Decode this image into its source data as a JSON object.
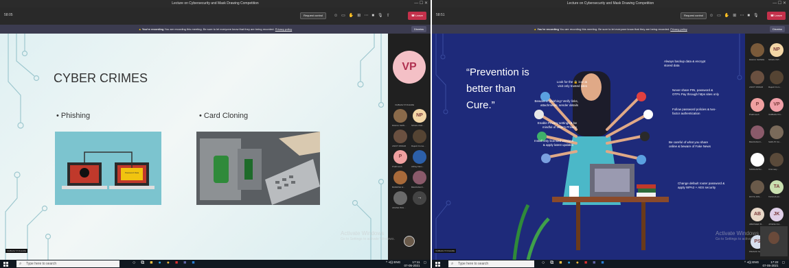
{
  "left": {
    "window_title": "Lecture on Cybersecurity and Mask Drawing Competition",
    "timer": "58:05",
    "request_control": "Request control",
    "leave": "Leave",
    "recording_prefix": "You're recording",
    "recording_notice": "You are recording this meeting. Be sure to let everyone know that they are being recorded.",
    "privacy_policy": "Privacy policy",
    "dismiss": "Dismiss",
    "slide": {
      "title": "CYBER CRIMES",
      "bullet1": "Phishing",
      "bullet2": "Card Cloning",
      "phish_sign": "Password Data"
    },
    "presenter": {
      "initials": "VP",
      "name": "VAIBHAV POKHARE"
    },
    "participants": [
      {
        "initials": "",
        "name": "RAHUL SHIN...",
        "color": "#8a6a4a"
      },
      {
        "initials": "NP",
        "name": "NIKHIL PAR...",
        "color": "#f3d6a6"
      },
      {
        "initials": "",
        "name": "ANKIT PAWAR",
        "color": "#6a5040"
      },
      {
        "initials": "",
        "name": "Rajesh Kuma...",
        "color": "#554433"
      },
      {
        "initials": "P",
        "name": "Prathmesh",
        "color": "#f0a0a0"
      },
      {
        "initials": "",
        "name": "Abhay Dam...",
        "color": "#2c5fa8"
      },
      {
        "initials": "",
        "name": "BANDISH H...",
        "color": "#a86a3a"
      },
      {
        "initials": "",
        "name": "BHAVANA D...",
        "color": "#8a5a6a"
      },
      {
        "initials": "",
        "name": "AKASH PAG...",
        "color": "#6a6a6a"
      }
    ],
    "more_count": "→",
    "bottom_label": "VAIBHAV POKHARE",
    "watermark_title": "Activate Windows",
    "watermark_sub": "Go to Settings to activate Windows.",
    "taskbar": {
      "search_placeholder": "Type here to search",
      "lang": "ENG",
      "time": "17:11",
      "date": "07-05-2021"
    }
  },
  "right": {
    "window_title": "Lecture on Cybersecurity and Mask Drawing Competition",
    "timer": "58:51",
    "request_control": "Request control",
    "leave": "Leave",
    "recording_prefix": "You're recording",
    "recording_notice": "You are recording this meeting. Be sure to let everyone know that they are being recorded.",
    "privacy_policy": "Privacy policy",
    "dismiss": "Dismiss",
    "slide": {
      "quote": "“Prevention is better than Cure.”",
      "tips_left": [
        "Look for the 🔒 icon & visit only trusted sites",
        "Beware of phishing! Verify links, attachments, sender details",
        "Enable Privacy settings & be mindful of other's Privacy",
        "Install only licensed versions & apply latest updates"
      ],
      "tips_right": [
        "Always backup data & encrypt stored data",
        "Never share PIN, password & OTPs Pay through https sites only",
        "Follow password policies & two-factor authentication",
        "Be careful of what you share online & beware of Fake News",
        "Change default router password & apply WPA2 + AES security"
      ]
    },
    "participants": [
      {
        "initials": "",
        "name": "RAHUL SHINDE",
        "color": "#7a5a3a"
      },
      {
        "initials": "NP",
        "name": "NIKHIL PAT...",
        "color": "#f3d6a6"
      },
      {
        "initials": "",
        "name": "ANKIT PAWAR",
        "color": "#6a5040"
      },
      {
        "initials": "",
        "name": "Rajesh Kum...",
        "color": "#554433"
      },
      {
        "initials": "P",
        "name": "Prathmesh",
        "color": "#f0a0a0"
      },
      {
        "initials": "VP",
        "name": "VAIBHAV PO...",
        "color": "#f0a0a8"
      },
      {
        "initials": "",
        "name": "BHAVANA D...",
        "color": "#8a5a6a"
      },
      {
        "initials": "",
        "name": "SHRUTI KA...",
        "color": "#7a6a5a"
      },
      {
        "initials": "",
        "name": "SIDDHARTH...",
        "color": "#ffffff"
      },
      {
        "initials": "",
        "name": "Chinmaiy...",
        "color": "#5a4a3a"
      },
      {
        "initials": "",
        "name": "DIVYA JOS...",
        "color": "#6a5a4a"
      },
      {
        "initials": "TA",
        "name": "TANUJA AU...",
        "color": "#c9e0b0"
      },
      {
        "initials": "AB",
        "name": "ABHISHEK B...",
        "color": "#e8d8c8"
      },
      {
        "initials": "JK",
        "name": "JAYESH KA...",
        "color": "#e0d0e8"
      },
      {
        "initials": "PS",
        "name": "PRANAV SA...",
        "color": "#d8e0f0"
      },
      {
        "initials": "",
        "name": "",
        "color": "#5a5a5a"
      }
    ],
    "bottom_label": "VAIBHAV POKHARE",
    "watermark_title": "Activate Windows",
    "watermark_sub": "Go to Settings to activate Windows.",
    "taskbar": {
      "search_placeholder": "Type here to search",
      "lang": "ENG",
      "time": "17:22",
      "date": "07-05-2021"
    }
  }
}
